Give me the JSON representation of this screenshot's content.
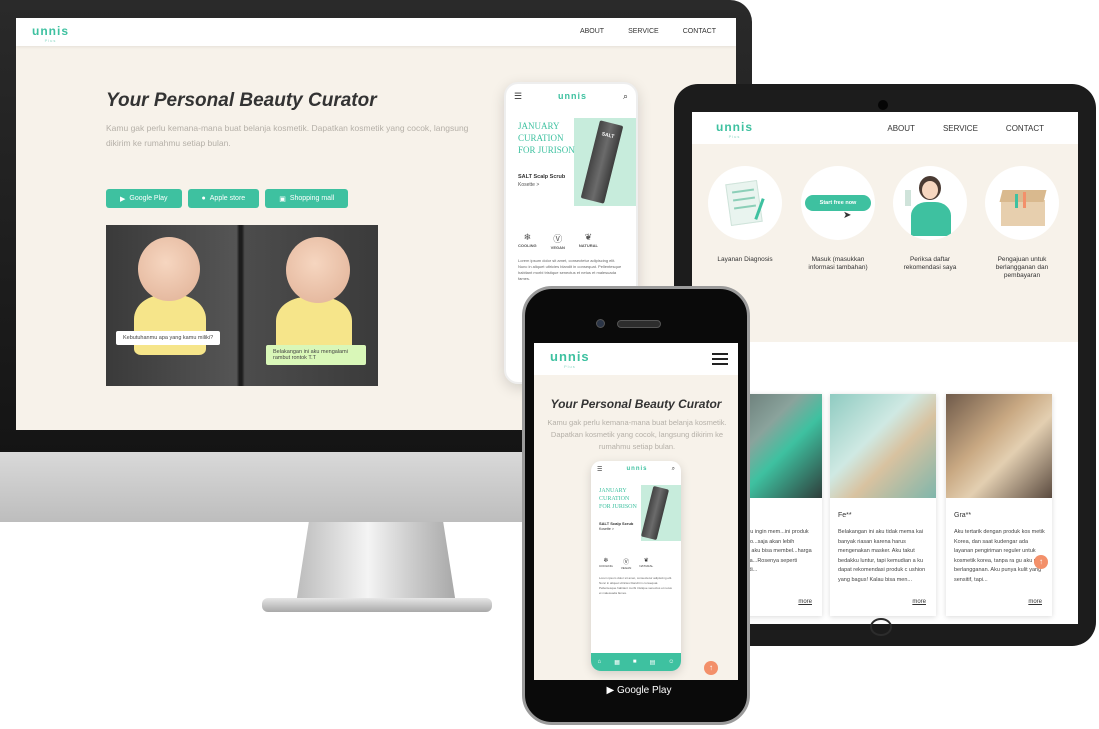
{
  "brand": {
    "logo": "unnis",
    "tagline": "Plus",
    "accent": "#3ec1a0",
    "accent_light": "#c7ecdc",
    "bg": "#f7f2ea",
    "orange": "#f3906a"
  },
  "nav": {
    "about": "ABOUT",
    "service": "SERVICE",
    "contact": "CONTACT"
  },
  "hero": {
    "title": "Your Personal Beauty Curator",
    "desc": "Kamu gak perlu kemana-mana buat belanja kosmetik. Dapatkan kosmetik yang cocok, langsung dikirim ke rumahmu setiap bulan."
  },
  "store_buttons": {
    "google_play": "Google Play",
    "apple_store": "Apple store",
    "shopping_mall": "Shopping mall"
  },
  "chat": {
    "left": "Kebutuhanmu apa yang kamu miliki?",
    "right": "Belakangan ini aku mengalami rambut rontok T.T"
  },
  "mini_app": {
    "curation_line1": "JANUARY",
    "curation_line2": "CURATION",
    "curation_line3": "FOR JURISON",
    "product": "SALT Scalp Scrub",
    "sub": "Kosette >",
    "tube_label": "SALT",
    "icons": [
      "COOLING",
      "VEGAN",
      "NATURAL"
    ],
    "lorem": "Lorem ipsum dolor sit amet, consectetur adipiscing elit. Nunc in aliquet ultricies blandit in consequat. Pellentesque habitant morbi tristique senectus et netus et malesuada fames."
  },
  "steps": [
    {
      "label": "Layanan Diagnosis"
    },
    {
      "label": "Masuk (masukkan informasi tambahan)",
      "pill": "Start free now"
    },
    {
      "label": "Periksa daftar rekomendasi saya"
    },
    {
      "label": "Pengajuan untuk berlangganan dan pembayaran"
    }
  ],
  "reviews": [
    {
      "name": "",
      "text": "...aku selalu ingin mem...ini produk kosmetik ko...saja akan lebih many...jika aku bisa membel...harga murah setia...Rosenya seperti mend...hadi...",
      "more": "more"
    },
    {
      "name": "Fe**",
      "text": "Belakangan ini aku tidak mema kai banyak riasan karena harus mengenakan masker. Aku takut bedakku luntur, tapi kemudian a ku dapat rekomendasi produk c ushion yang bagus! Kalau bisa men...",
      "more": "more"
    },
    {
      "name": "Gra**",
      "text": "Aku tertarik dengan produk kos metik Korea, dan saat kudengar ada layanan pengiriman reguler untuk kosmetik korea, tanpa ra gu aku pun berlangganan. Aku punya kulit yang sensitif, tapi...",
      "more": "more"
    }
  ],
  "scroll_top": "↑"
}
